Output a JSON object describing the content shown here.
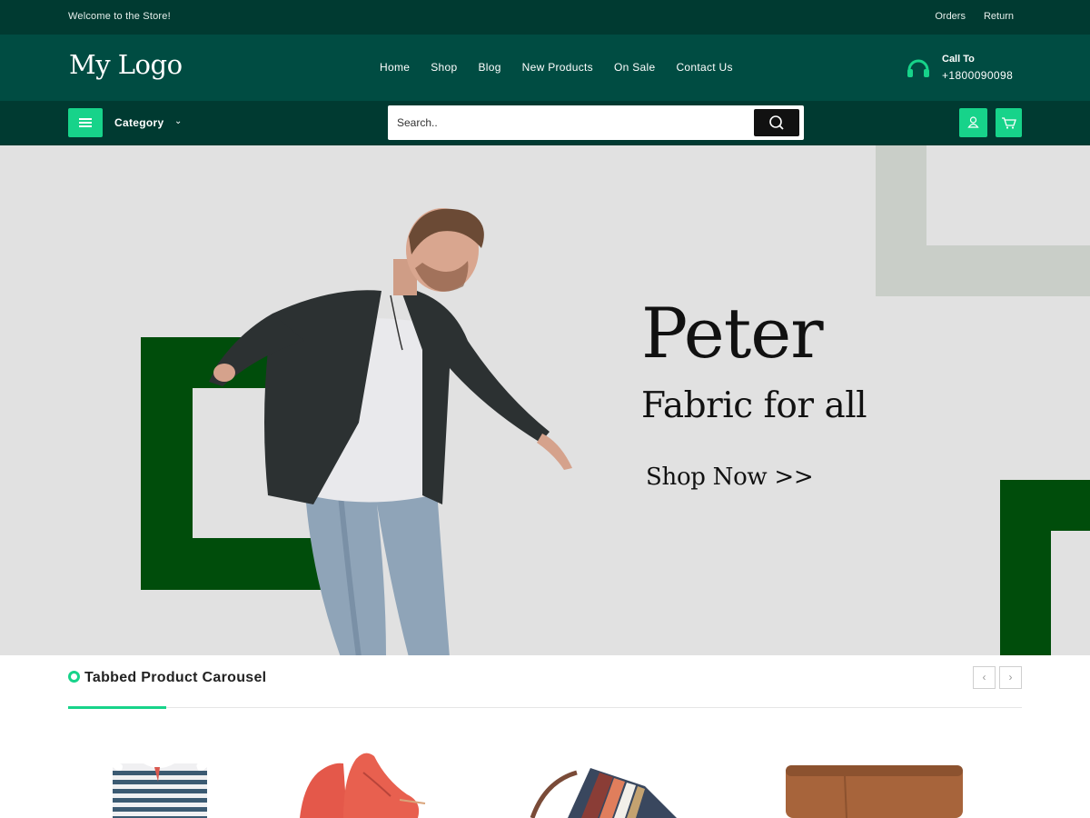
{
  "topbar": {
    "welcome": "Welcome to the Store!",
    "links": [
      "Orders",
      "Return"
    ]
  },
  "header": {
    "logo": "My Logo",
    "nav": [
      "Home",
      "Shop",
      "Blog",
      "New Products",
      "On Sale",
      "Contact Us"
    ],
    "call_label": "Call To",
    "call_number": "+1800090098",
    "call_icon": "headphones-icon"
  },
  "toolbar": {
    "menu_icon": "hamburger-icon",
    "category_label": "Category",
    "category_icon": "chevron-down-icon",
    "search_placeholder": "Search..",
    "search_icon": "search-icon",
    "user_icon": "user-icon",
    "cart_icon": "cart-icon"
  },
  "hero": {
    "title": "Peter",
    "subtitle": "Fabric for all",
    "cta": "Shop Now >>"
  },
  "section": {
    "title": "Tabbed Product Carousel",
    "prev_icon": "chevron-left-icon",
    "next_icon": "chevron-right-icon"
  },
  "products": [
    {
      "depicts": "striped-shirt"
    },
    {
      "depicts": "red-shoes"
    },
    {
      "depicts": "striped-wallet"
    },
    {
      "depicts": "brown-leather-case"
    }
  ],
  "colors": {
    "topbar": "#003a31",
    "header": "#004c42",
    "accent": "#17d38a",
    "hero_bg": "#e1e1e1",
    "hero_green": "#004d0b",
    "hero_grey": "#c9cec8"
  }
}
